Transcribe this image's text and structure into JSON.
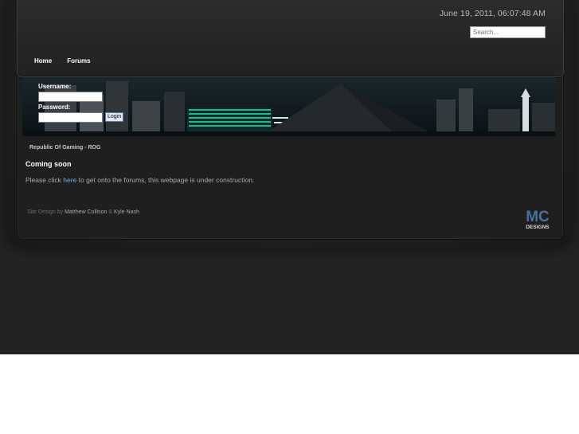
{
  "header": {
    "datetime": "June 19, 2011, 06:07:48 AM",
    "search_placeholder": "Search..."
  },
  "nav": {
    "items": [
      {
        "label": "Home"
      },
      {
        "label": "Forums"
      }
    ]
  },
  "login": {
    "username_label": "Username:",
    "password_label": "Password:",
    "username_value": "",
    "password_value": "",
    "button_label": "Login"
  },
  "content": {
    "breadcrumb": "Republic Of Gaming - ROG",
    "heading": "Coming soon",
    "message_before": "Please click ",
    "message_link": "here",
    "message_after": " to get onto the forums, this webpage is under construction."
  },
  "footer": {
    "credits_prefix": "Site Design by ",
    "author1": "Matthew Collison",
    "credits_sep": " & ",
    "author2": "Kyle Nash",
    "logo_top": "MC",
    "logo_bottom": "DESIGNS"
  },
  "colors": {
    "page_background": "#232323",
    "link": "#6ea9d8",
    "logo_blue": "#4a6f9c"
  }
}
